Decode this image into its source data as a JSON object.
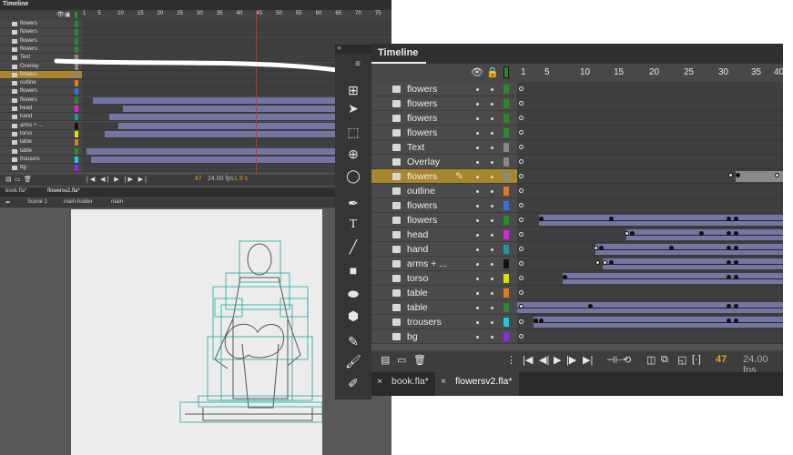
{
  "small_timeline": {
    "title": "Timeline",
    "frame_numbers": [
      "1",
      "5",
      "10",
      "15",
      "20",
      "25",
      "30",
      "35",
      "40",
      "45",
      "50",
      "55",
      "60",
      "65",
      "70",
      "75"
    ],
    "layers": [
      {
        "name": "flowers",
        "color": "#2a8a2a"
      },
      {
        "name": "flowers",
        "color": "#2a8a2a"
      },
      {
        "name": "flowers",
        "color": "#2a8a2a"
      },
      {
        "name": "flowers",
        "color": "#2a8a2a"
      },
      {
        "name": "Text",
        "color": "#888888"
      },
      {
        "name": "Overlay",
        "color": "#888888"
      },
      {
        "name": "flowers",
        "color": "#888888",
        "selected": true
      },
      {
        "name": "outline",
        "color": "#e07a1c"
      },
      {
        "name": "flowers",
        "color": "#3a6fe0"
      },
      {
        "name": "flowers",
        "color": "#2a8a2a"
      },
      {
        "name": "head",
        "color": "#e020e0"
      },
      {
        "name": "hand",
        "color": "#1a9a9a"
      },
      {
        "name": "arms + ...",
        "color": "#111111"
      },
      {
        "name": "torso",
        "color": "#e0e000"
      },
      {
        "name": "table",
        "color": "#e07a1c"
      },
      {
        "name": "table",
        "color": "#2a8a2a"
      },
      {
        "name": "trousers",
        "color": "#10d0e0"
      },
      {
        "name": "bg",
        "color": "#8a2ae0"
      }
    ],
    "status": {
      "frame": "47",
      "fps": "24.00 fps",
      "time": "1.9 s"
    },
    "tabs": [
      "book.fla*",
      "flowersv2.fla*"
    ],
    "breadcrumb": [
      "Scene 1",
      "main-holder",
      "main"
    ]
  },
  "timeline": {
    "title": "Timeline",
    "frame_numbers": [
      "1",
      "5",
      "10",
      "15",
      "20",
      "25",
      "30",
      "35",
      "40"
    ],
    "layers": [
      {
        "name": "flowers",
        "color": "#2a8a2a"
      },
      {
        "name": "flowers",
        "color": "#2a8a2a"
      },
      {
        "name": "flowers",
        "color": "#2a8a2a"
      },
      {
        "name": "flowers",
        "color": "#2a8a2a"
      },
      {
        "name": "Text",
        "color": "#888888"
      },
      {
        "name": "Overlay",
        "color": "#888888"
      },
      {
        "name": "flowers",
        "color": "#888888",
        "selected": true
      },
      {
        "name": "outline",
        "color": "#e07a1c"
      },
      {
        "name": "flowers",
        "color": "#3a6fe0"
      },
      {
        "name": "flowers",
        "color": "#2a8a2a"
      },
      {
        "name": "head",
        "color": "#e020e0"
      },
      {
        "name": "hand",
        "color": "#1a9a9a"
      },
      {
        "name": "arms + ...",
        "color": "#111111"
      },
      {
        "name": "torso",
        "color": "#e0e000"
      },
      {
        "name": "table",
        "color": "#e07a1c"
      },
      {
        "name": "table",
        "color": "#2a8a2a"
      },
      {
        "name": "trousers",
        "color": "#10d0e0"
      },
      {
        "name": "bg",
        "color": "#8a2ae0"
      }
    ],
    "current_frame": "47",
    "fps": "24.00 fps",
    "tabs": [
      "book.fla*",
      "flowersv2.fla*"
    ],
    "close_glyph": "×"
  }
}
